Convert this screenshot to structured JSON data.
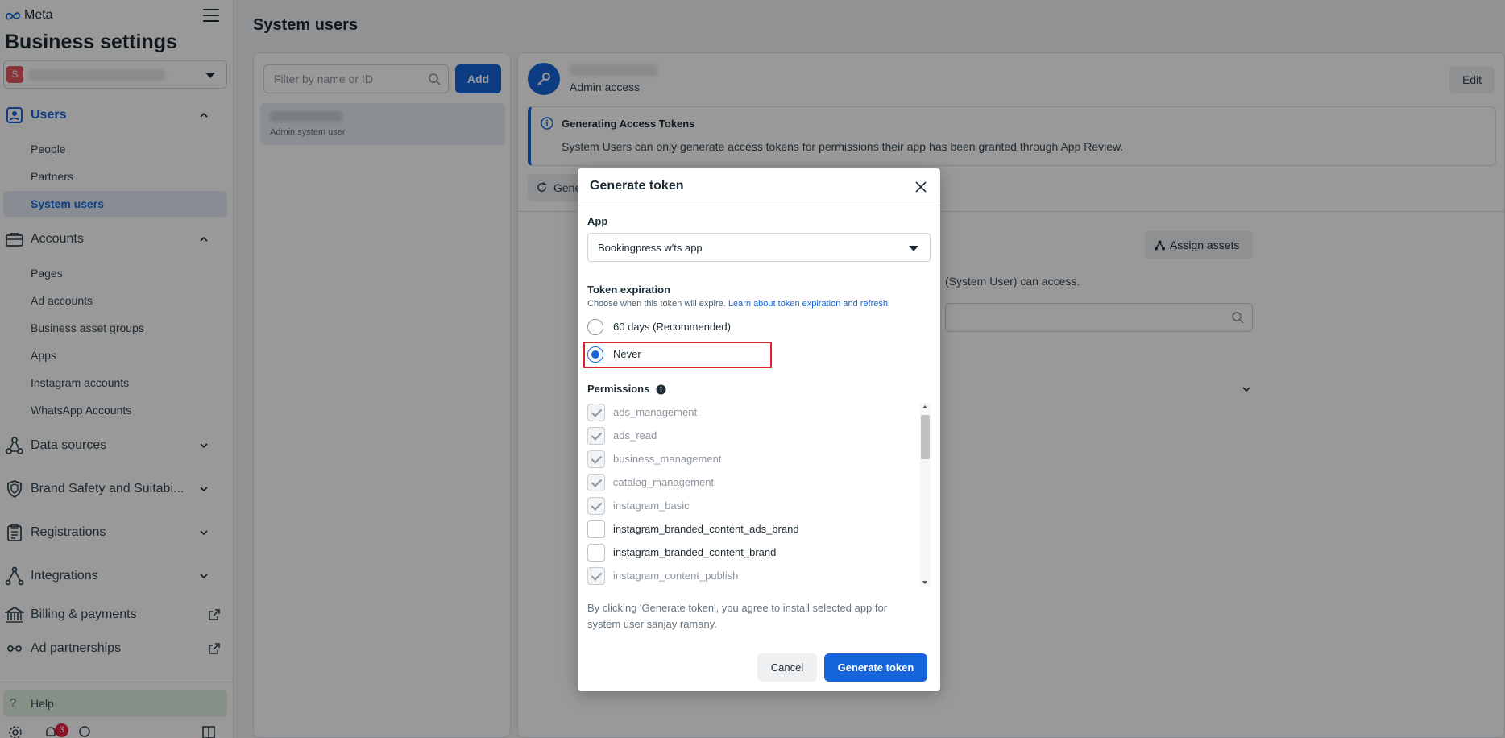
{
  "brand": {
    "name": "Meta"
  },
  "sidebar": {
    "title": "Business settings",
    "business_badge": "S",
    "groups": [
      {
        "label": "Users",
        "items": [
          "People",
          "Partners",
          "System users"
        ]
      },
      {
        "label": "Accounts",
        "items": [
          "Pages",
          "Ad accounts",
          "Business asset groups",
          "Apps",
          "Instagram accounts",
          "WhatsApp Accounts"
        ]
      },
      {
        "label": "Data sources"
      },
      {
        "label": "Brand Safety and Suitabi..."
      },
      {
        "label": "Registrations"
      },
      {
        "label": "Integrations"
      },
      {
        "label": "Billing & payments"
      },
      {
        "label": "Ad partnerships"
      }
    ],
    "help_label": "Help",
    "notification_count": "3"
  },
  "main": {
    "page_title": "System users",
    "filter_placeholder": "Filter by name or ID",
    "add_label": "Add",
    "user_row_sub": "Admin system user"
  },
  "detail": {
    "access_label": "Admin access",
    "edit_label": "Edit",
    "info_title": "Generating Access Tokens",
    "info_body": "System Users can only generate access tokens for permissions their app has been granted through App Review.",
    "generate_partial": "Gene",
    "assign_assets_label": "Assign assets",
    "can_access_partial": "(System User) can access."
  },
  "modal": {
    "title": "Generate token",
    "app_label": "App",
    "app_value": "Bookingpress w'ts app",
    "expiration_label": "Token expiration",
    "expiration_desc": "Choose when this token will expire.",
    "expiration_link": "Learn about token expiration and refresh.",
    "option_60_days": "60 days (Recommended)",
    "option_never": "Never",
    "permissions_label": "Permissions",
    "permissions": [
      {
        "name": "ads_management",
        "checked": true,
        "disabled": true
      },
      {
        "name": "ads_read",
        "checked": true,
        "disabled": true
      },
      {
        "name": "business_management",
        "checked": true,
        "disabled": true
      },
      {
        "name": "catalog_management",
        "checked": true,
        "disabled": true
      },
      {
        "name": "instagram_basic",
        "checked": true,
        "disabled": true
      },
      {
        "name": "instagram_branded_content_ads_brand",
        "checked": false,
        "disabled": false
      },
      {
        "name": "instagram_branded_content_brand",
        "checked": false,
        "disabled": false
      },
      {
        "name": "instagram_content_publish",
        "checked": true,
        "disabled": true
      }
    ],
    "agree_text": "By clicking 'Generate token', you agree to install selected app for system user sanjay ramany.",
    "cancel_label": "Cancel",
    "generate_label": "Generate token"
  },
  "colors": {
    "accent": "#1664d9",
    "highlight": "#d9252b"
  }
}
